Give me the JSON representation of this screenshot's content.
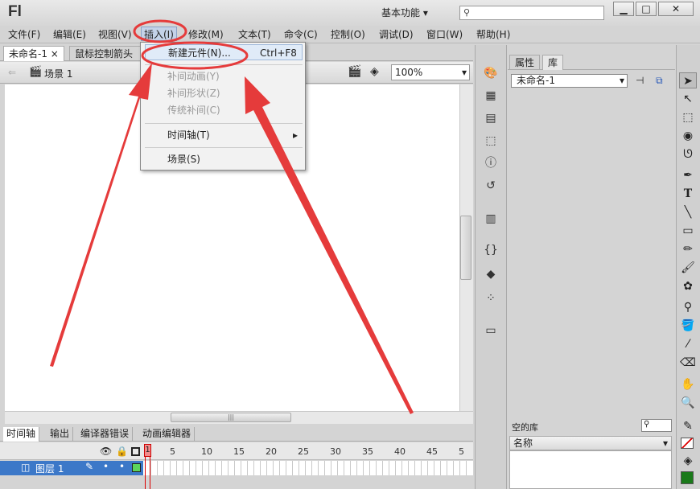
{
  "app": {
    "logo": "Fl",
    "workspace": "基本功能",
    "workspace_arrow": "▾"
  },
  "window_buttons": {
    "minimize": "▁",
    "maximize": "□",
    "close": "✕"
  },
  "menubar": [
    {
      "label": "文件(F)"
    },
    {
      "label": "编辑(E)"
    },
    {
      "label": "视图(V)"
    },
    {
      "label": "插入(I)"
    },
    {
      "label": "修改(M)"
    },
    {
      "label": "文本(T)"
    },
    {
      "label": "命令(C)"
    },
    {
      "label": "控制(O)"
    },
    {
      "label": "调试(D)"
    },
    {
      "label": "窗口(W)"
    },
    {
      "label": "帮助(H)"
    }
  ],
  "doc_tabs": [
    {
      "label": "未命名-1",
      "close": "×"
    },
    {
      "label": "鼠标控制箭头"
    }
  ],
  "editbar": {
    "scene": "场景 1",
    "zoom": "100%"
  },
  "insert_menu": {
    "items": [
      {
        "label": "新建元件(N)...",
        "shortcut": "Ctrl+F8",
        "enabled": true
      },
      {
        "label": "补间动画(Y)",
        "enabled": false
      },
      {
        "label": "补间形状(Z)",
        "enabled": false
      },
      {
        "label": "传统补间(C)",
        "enabled": false
      },
      {
        "label": "时间轴(T)",
        "enabled": true,
        "submenu": "▸"
      },
      {
        "label": "场景(S)",
        "enabled": true
      }
    ]
  },
  "timeline": {
    "tabs": [
      "时间轴",
      "输出",
      "编译器错误",
      "动画编辑器"
    ],
    "frame_numbers": [
      "1",
      "5",
      "10",
      "15",
      "20",
      "25",
      "30",
      "35",
      "40",
      "45",
      "5"
    ],
    "layer_name": "图层 1"
  },
  "properties_panel": {
    "tabs": [
      "属性",
      "库"
    ],
    "library_doc": "未命名-1",
    "empty_library": "空的库",
    "name_column": "名称"
  },
  "colors": {
    "accent_red": "#e53b3b",
    "layer_highlight": "#3c78c8",
    "fill_swatch": "#1a7a1a"
  }
}
